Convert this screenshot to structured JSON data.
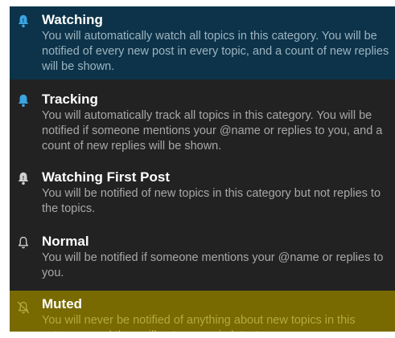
{
  "notification_levels": [
    {
      "key": "watching",
      "icon": "bell-icon",
      "icon_color": "#3aa5e0",
      "title": "Watching",
      "description": "You will automatically watch all topics in this category. You will be notified of every new post in every topic, and a count of new replies will be shown."
    },
    {
      "key": "tracking",
      "icon": "bell-icon",
      "icon_color": "#3aa5e0",
      "title": "Tracking",
      "description": "You will automatically track all topics in this category. You will be notified if someone mentions your @name or replies to you, and a count of new replies will be shown."
    },
    {
      "key": "watching-first-post",
      "icon": "bell-icon",
      "icon_color": "#d0d0d0",
      "title": "Watching First Post",
      "description": "You will be notified of new topics in this category but not replies to the topics."
    },
    {
      "key": "normal",
      "icon": "bell-outline-icon",
      "icon_color": "#d0d0d0",
      "title": "Normal",
      "description": "You will be notified if someone mentions your @name or replies to you."
    },
    {
      "key": "muted",
      "icon": "bell-slash-icon",
      "icon_color": "#b3a93e",
      "title": "Muted",
      "description": "You will never be notified of anything about new topics in this category, and they will not appear in latest."
    }
  ],
  "colors": {
    "menu_background": "#222222",
    "selected_background": "#0c3349",
    "muted_highlight": "#786a00",
    "title_text": "#ffffff",
    "description_text": "#a8a8a8"
  }
}
